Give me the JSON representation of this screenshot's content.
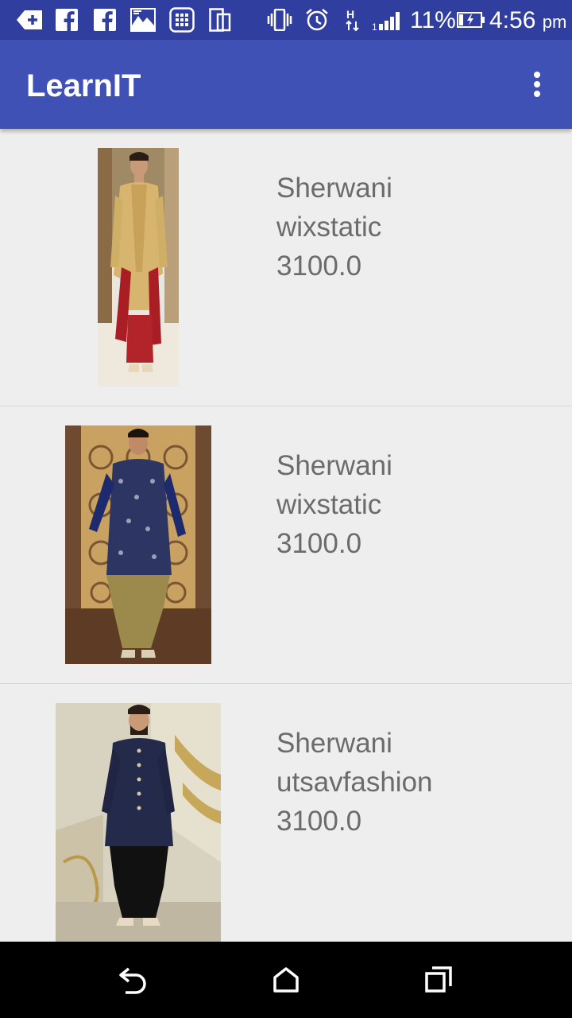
{
  "status_bar": {
    "icons": [
      "add-icon",
      "facebook-icon",
      "facebook-icon",
      "gallery-icon",
      "apps-icon",
      "sim-icon",
      "vibrate-icon",
      "alarm-icon",
      "data-h-icon",
      "signal-icon",
      "battery-charging-icon"
    ],
    "battery_percent": "11%",
    "time": "4:56",
    "ampm": "pm"
  },
  "app_bar": {
    "title": "LearnIT",
    "menu_icon": "overflow-menu-icon"
  },
  "products": [
    {
      "name": "Sherwani",
      "source": "wixstatic",
      "price": "3100.0",
      "image": "sherwani-gold-image"
    },
    {
      "name": "Sherwani",
      "source": "wixstatic",
      "price": "3100.0",
      "image": "sherwani-navy-brocade-image"
    },
    {
      "name": "Sherwani",
      "source": "utsavfashion",
      "price": "3100.0",
      "image": "sherwani-navy-image"
    }
  ],
  "nav_bar": {
    "back_icon": "back-icon",
    "home_icon": "home-icon",
    "recents_icon": "recents-icon"
  },
  "colors": {
    "status_bar": "#303f9f",
    "app_bar": "#3f51b5",
    "list_background": "#eeeeee",
    "item_text": "#6b6b6b"
  }
}
